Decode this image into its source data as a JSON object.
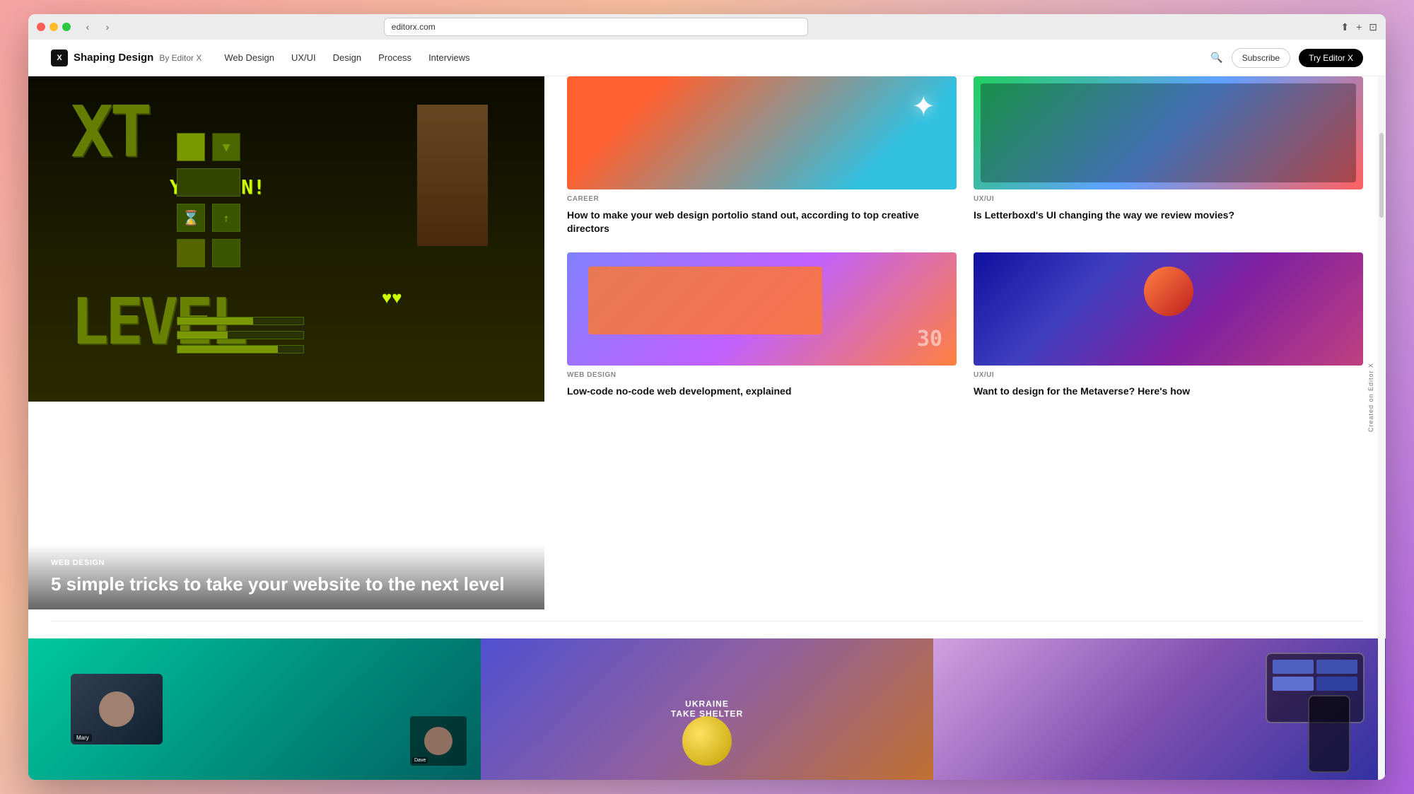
{
  "browser": {
    "url": "editorx.com",
    "title": "Shaping Design – By Editor X"
  },
  "nav": {
    "logo": "Shaping Design",
    "logo_sub": "By Editor X",
    "logo_icon": "X",
    "links": [
      "Web Design",
      "UX/UI",
      "Design",
      "Process",
      "Interviews"
    ],
    "subscribe_label": "Subscribe",
    "try_label": "Try Editor X"
  },
  "hero_article": {
    "category": "WEB DESIGN",
    "title": "5 simple tricks to take your website to the next level"
  },
  "articles": [
    {
      "category": "CAREER",
      "title": "How to make your web design portolio stand out, according to top creative directors"
    },
    {
      "category": "UX/UI",
      "title": "Is Letterboxd's UI changing the way we review movies?"
    },
    {
      "category": "WEB DESIGN",
      "title": "Low-code no-code web development, explained"
    },
    {
      "category": "UX/UI",
      "title": "Want to design for the Metaverse? Here's how"
    }
  ],
  "bottom_section": {
    "ukraine_title": "UKRAINE",
    "ukraine_subtitle": "TAKE SHELTER",
    "person1_name": "Mary",
    "person2_name": "Dave"
  },
  "editor_badge": "Created on Editor X"
}
